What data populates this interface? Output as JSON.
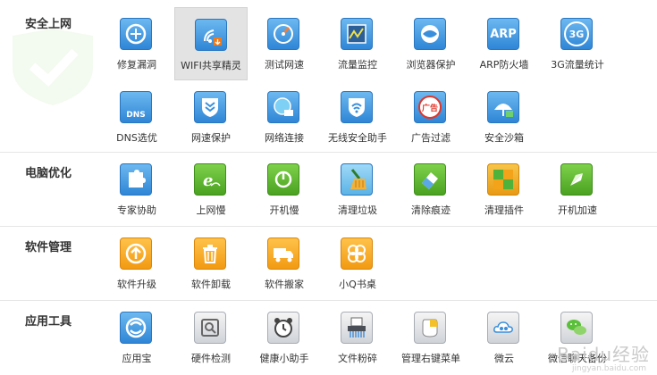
{
  "sections": [
    {
      "title": "安全上网",
      "items": [
        {
          "label": "修复漏洞",
          "icon": "repair-vulnerability-icon"
        },
        {
          "label": "WIFI共享精灵",
          "icon": "wifi-share-icon"
        },
        {
          "label": "测试网速",
          "icon": "speed-test-icon"
        },
        {
          "label": "流量监控",
          "icon": "traffic-monitor-icon"
        },
        {
          "label": "浏览器保护",
          "icon": "browser-protect-icon"
        },
        {
          "label": "ARP防火墙",
          "icon": "arp-firewall-icon",
          "text": "ARP"
        },
        {
          "label": "3G流量统计",
          "icon": "3g-traffic-icon",
          "text": "3G"
        },
        {
          "label": "DNS选优",
          "icon": "dns-icon",
          "text": "DNS"
        },
        {
          "label": "网速保护",
          "icon": "speed-protect-icon"
        },
        {
          "label": "网络连接",
          "icon": "network-connect-icon"
        },
        {
          "label": "无线安全助手",
          "icon": "wireless-security-icon"
        },
        {
          "label": "广告过滤",
          "icon": "ad-filter-icon",
          "text": "广告"
        },
        {
          "label": "安全沙箱",
          "icon": "sandbox-icon"
        }
      ]
    },
    {
      "title": "电脑优化",
      "items": [
        {
          "label": "专家协助",
          "icon": "expert-assist-icon"
        },
        {
          "label": "上网慢",
          "icon": "slow-internet-icon"
        },
        {
          "label": "开机慢",
          "icon": "slow-boot-icon"
        },
        {
          "label": "清理垃圾",
          "icon": "clean-junk-icon"
        },
        {
          "label": "清除痕迹",
          "icon": "clear-traces-icon"
        },
        {
          "label": "清理插件",
          "icon": "clean-plugins-icon"
        },
        {
          "label": "开机加速",
          "icon": "boot-accelerate-icon"
        }
      ]
    },
    {
      "title": "软件管理",
      "items": [
        {
          "label": "软件升级",
          "icon": "software-upgrade-icon"
        },
        {
          "label": "软件卸载",
          "icon": "software-uninstall-icon"
        },
        {
          "label": "软件搬家",
          "icon": "software-move-icon"
        },
        {
          "label": "小Q书桌",
          "icon": "q-desk-icon"
        }
      ]
    },
    {
      "title": "应用工具",
      "items": [
        {
          "label": "应用宝",
          "icon": "app-treasure-icon"
        },
        {
          "label": "硬件检测",
          "icon": "hardware-check-icon"
        },
        {
          "label": "健康小助手",
          "icon": "health-assistant-icon"
        },
        {
          "label": "文件粉碎",
          "icon": "file-shredder-icon"
        },
        {
          "label": "管理右键菜单",
          "icon": "context-menu-icon"
        },
        {
          "label": "微云",
          "icon": "weiyun-icon"
        },
        {
          "label": "微信聊天备份",
          "icon": "wechat-backup-icon"
        }
      ]
    }
  ],
  "watermark": "Baidu经验",
  "watermark_sub": "jingyan.baidu.com"
}
